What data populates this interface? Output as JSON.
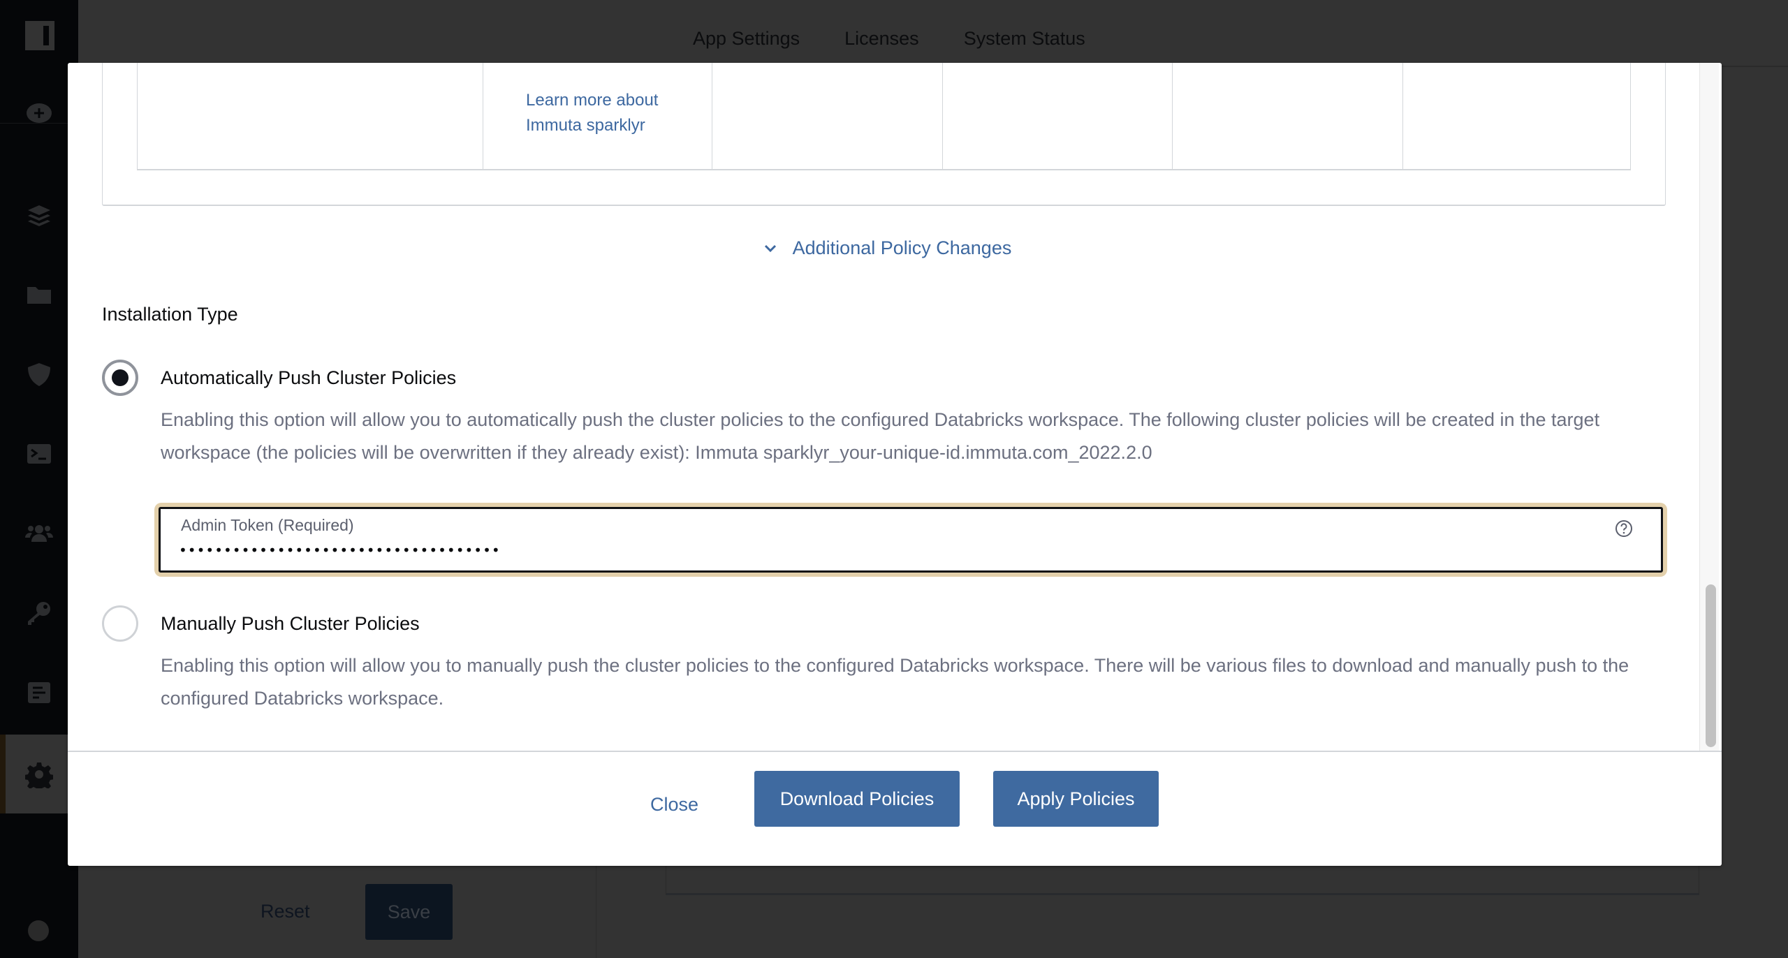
{
  "topnav": {
    "tabs": [
      "App Settings",
      "Licenses",
      "System Status"
    ]
  },
  "sidebar": {
    "items": [
      {
        "icon": "plus-circle-icon"
      },
      {
        "icon": "layers-icon"
      },
      {
        "icon": "folder-icon"
      },
      {
        "icon": "shield-icon"
      },
      {
        "icon": "terminal-icon"
      },
      {
        "icon": "users-icon"
      },
      {
        "icon": "key-icon"
      },
      {
        "icon": "report-icon"
      },
      {
        "icon": "gear-icon",
        "active": true
      },
      {
        "icon": "arrow-right-circle-icon"
      }
    ]
  },
  "background": {
    "reset_label": "Reset",
    "save_label": "Save"
  },
  "modal": {
    "table": {
      "link_text": "Learn more about Immuta sparklyr"
    },
    "additional_toggle": "Additional Policy Changes",
    "installation_type_title": "Installation Type",
    "options": [
      {
        "label": "Automatically Push Cluster Policies",
        "selected": true,
        "description": "Enabling this option will allow you to automatically push the cluster policies to the configured Databricks workspace. The following cluster policies will be created in the target workspace (the policies will be overwritten if they already exist): Immuta sparklyr_your-unique-id.immuta.com_2022.2.0"
      },
      {
        "label": "Manually Push Cluster Policies",
        "selected": false,
        "description": "Enabling this option will allow you to manually push the cluster policies to the configured Databricks workspace. There will be various files to download and manually push to the configured Databricks workspace."
      }
    ],
    "admin_token": {
      "label": "Admin Token (Required)",
      "value": "••••••••••••••••••••••••••••••••••••"
    },
    "footer": {
      "close_label": "Close",
      "download_label": "Download Policies",
      "apply_label": "Apply Policies"
    }
  },
  "colors": {
    "accent": "#3f6aa0",
    "link": "#3d68a0",
    "focus_ring": "#e3d0ab",
    "sidebar_bg": "#050608",
    "overlay_bg": "#333333"
  }
}
